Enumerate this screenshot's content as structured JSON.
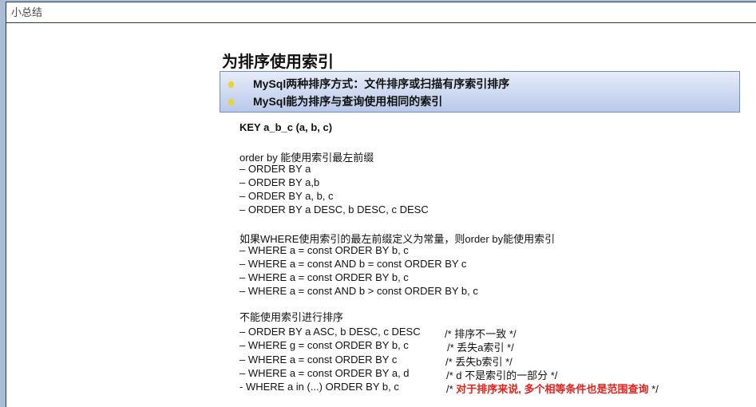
{
  "window": {
    "title": "小总结"
  },
  "slide": {
    "title": "为排序使用索引",
    "bullets": [
      "MySql两种排序方式：文件排序或扫描有序索引排序",
      "MySql能为排序与查询使用相同的索引"
    ],
    "key": "KEY a_b_c (a, b, c)",
    "s1": {
      "head": "order by 能使用索引最左前缀",
      "lines": [
        "– ORDER BY a",
        "– ORDER BY a,b",
        "– ORDER BY a, b, c",
        "– ORDER BY a DESC, b DESC, c DESC"
      ]
    },
    "s2": {
      "head": "如果WHERE使用索引的最左前缀定义为常量，则order by能使用索引",
      "lines": [
        "– WHERE a = const ORDER BY b, c",
        "– WHERE a = const AND b = const ORDER BY c",
        "– WHERE a = const ORDER BY b, c",
        "– WHERE a = const AND b > const ORDER BY b, c"
      ]
    },
    "s3": {
      "head": "不能使用索引进行排序",
      "lines": [
        "– ORDER BY a ASC, b DESC, c DESC",
        "– WHERE g = const ORDER BY b, c",
        "– WHERE a = const ORDER BY c",
        "– WHERE a = const ORDER BY a, d",
        "- WHERE a in (...) ORDER BY b, c"
      ],
      "comments": [
        "/* 排序不一致 */",
        "/* 丢失a索引 */",
        "/* 丢失b索引 */",
        "/* d 不是索引的一部分 */"
      ],
      "last_comment": {
        "open": "/* ",
        "red": "对于排序来说, 多个相等条件也是范围查询",
        "close": " */"
      }
    }
  }
}
